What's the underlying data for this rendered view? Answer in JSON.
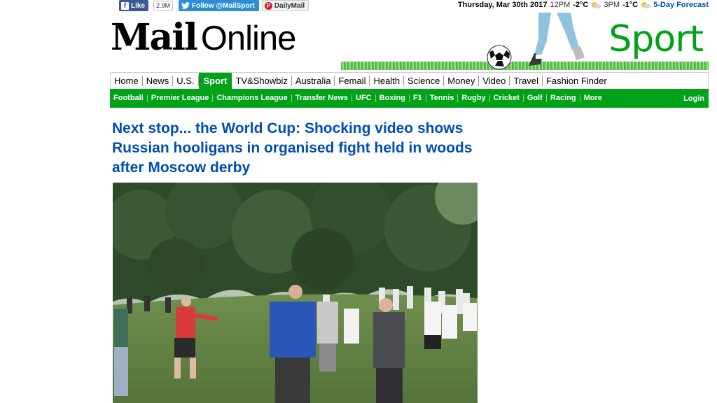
{
  "social": {
    "facebook_label": "Like",
    "facebook_count": "2.9M",
    "twitter_label": "Follow @MailSport",
    "pinterest_label": "DailyMail"
  },
  "weather": {
    "date": "Thursday, Mar 30th 2017",
    "time1": "12PM",
    "temp1": "-2°C",
    "time2": "3PM",
    "temp2": "-1°C",
    "forecast_link": "5-Day Forecast"
  },
  "masthead": {
    "logo_bold": "Mail",
    "logo_light": "Online",
    "section_title": "Sport"
  },
  "nav": {
    "items": [
      "Home",
      "News",
      "U.S.",
      "Sport",
      "TV&Showbiz",
      "Australia",
      "Femail",
      "Health",
      "Science",
      "Money",
      "Video",
      "Travel",
      "Fashion Finder"
    ],
    "active": "Sport"
  },
  "subnav": {
    "items": [
      "Football",
      "Premier League",
      "Champions League",
      "Transfer News",
      "UFC",
      "Boxing",
      "F1",
      "Tennis",
      "Rugby",
      "Cricket",
      "Golf",
      "Racing",
      "More"
    ],
    "login": "Login"
  },
  "article": {
    "headline": "Next stop... the World Cup: Shocking video shows Russian hooligans in organised fight held in woods after Moscow derby"
  },
  "colors": {
    "sport_green": "#00a318",
    "headline_blue": "#004db3",
    "facebook_blue": "#3b5998",
    "twitter_blue": "#2b8fd6"
  }
}
